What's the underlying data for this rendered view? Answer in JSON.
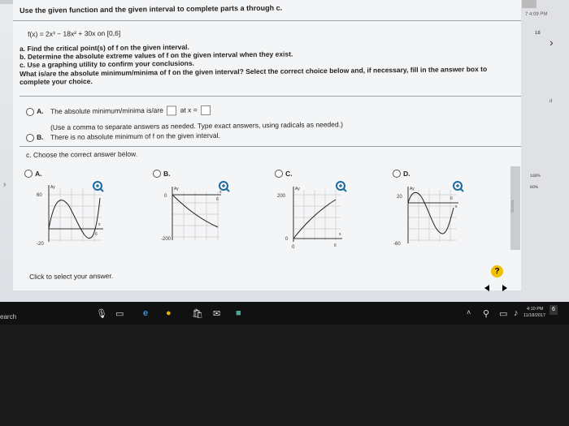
{
  "header": {
    "instruction": "Use the given function and the given interval to complete parts a through c.",
    "function": "f(x) = 2x³ − 18x² + 30x on [0,6]"
  },
  "parts": {
    "a": "a. Find the critical point(s) of f on the given interval.",
    "b": "b. Determine the absolute extreme values of f on the given interval when they exist.",
    "c": "c. Use a graphing utility to confirm your conclusions.",
    "question": "What is/are the absolute minimum/minima of f on the given interval? Select the correct choice below and, if necessary, fill in the answer box to",
    "question2": "complete your choice."
  },
  "choice_a": {
    "letter": "A.",
    "text": "The absolute minimum/minima is/are",
    "at": "at x =",
    "hint": "(Use a comma to separate answers as needed. Type exact answers, using radicals as needed.)"
  },
  "choice_b": {
    "letter": "B.",
    "text": "There is no absolute minimum of f on the given interval."
  },
  "part_c": {
    "prompt": "c. Choose the correct answer below."
  },
  "graph_choices": [
    {
      "letter": "A.",
      "top_label": "60",
      "bottom_label": "-20",
      "x_label": "x",
      "y_label": "Ay",
      "x_tick": "6"
    },
    {
      "letter": "B.",
      "top_label": "0",
      "bottom_label": "-200",
      "x_label": "x",
      "y_label": "Ay",
      "x_tick": "6"
    },
    {
      "letter": "C.",
      "top_label": "200",
      "bottom_label": "0",
      "x_label": "x",
      "y_label": "Ay",
      "x_tick": "6",
      "x0": "0"
    },
    {
      "letter": "D.",
      "top_label": "20",
      "bottom_label": "-60",
      "x_label": "x",
      "y_label": "Ay",
      "x_tick": "6"
    }
  ],
  "footer": {
    "click_prompt": "Click to select your answer.",
    "help": "?"
  },
  "sidebar": {
    "time": "7 4:09 PM",
    "number": "18",
    "pct1": "100%",
    "pct2": "80%",
    "scores": "Scores"
  },
  "taskbar": {
    "search": "earch",
    "time": "4:10 PM",
    "date": "11/18/2017",
    "notif": "6"
  }
}
